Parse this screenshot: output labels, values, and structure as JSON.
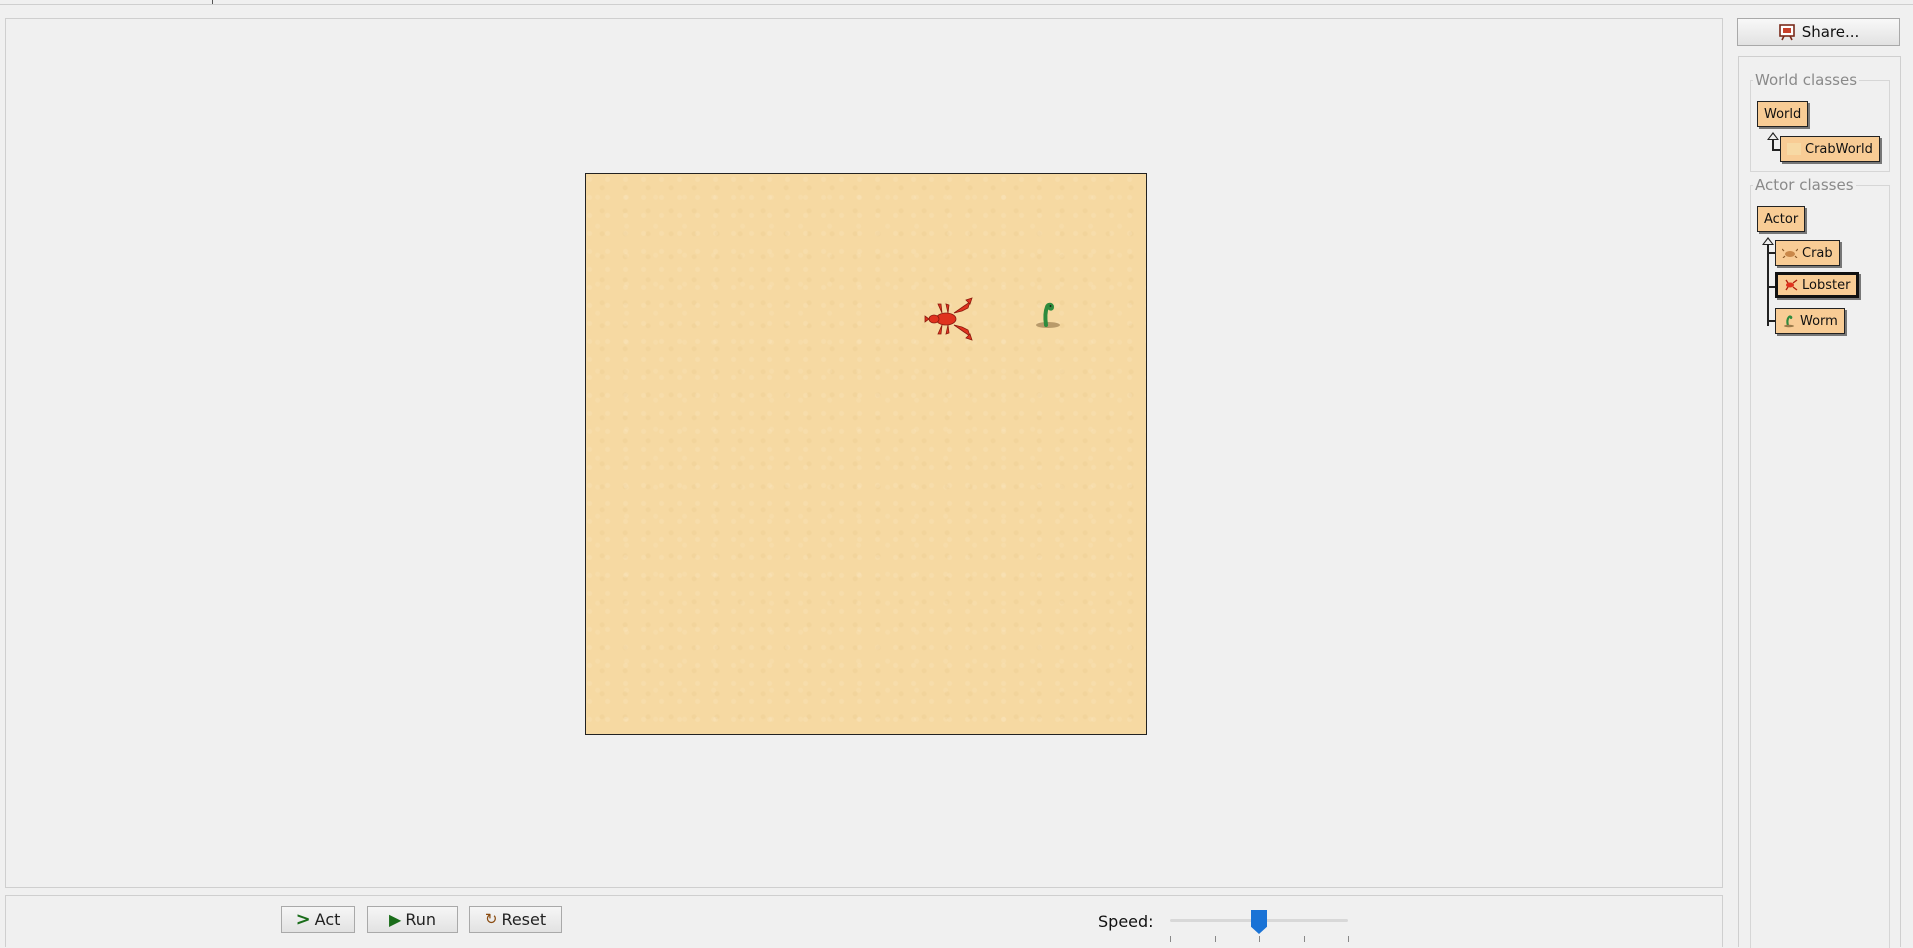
{
  "toolbar": {
    "share_label": "Share..."
  },
  "world_classes": {
    "title": "World classes",
    "items": [
      "World",
      "CrabWorld"
    ]
  },
  "actor_classes": {
    "title": "Actor classes",
    "root": "Actor",
    "items": [
      {
        "label": "Crab",
        "icon": "crab-icon",
        "selected": false
      },
      {
        "label": "Lobster",
        "icon": "lobster-icon",
        "selected": true
      },
      {
        "label": "Worm",
        "icon": "worm-icon",
        "selected": false
      }
    ]
  },
  "controls": {
    "act_label": "Act",
    "run_label": "Run",
    "reset_label": "Reset",
    "speed_label": "Speed:",
    "speed_value": 0.5
  },
  "world": {
    "background": "sand",
    "actors": [
      {
        "type": "Lobster",
        "icon": "lobster-icon"
      },
      {
        "type": "Worm",
        "icon": "worm-icon"
      }
    ]
  },
  "colors": {
    "class_box": "#f8cc95",
    "sand": "#f6d9a2",
    "slider_thumb": "#1a73d6"
  }
}
